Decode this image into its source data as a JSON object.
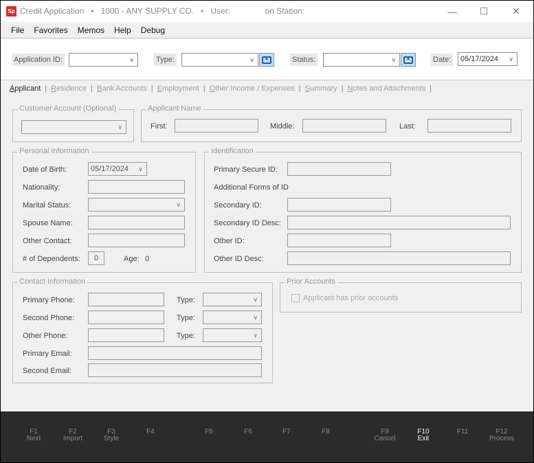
{
  "window": {
    "logo_text": "Sp",
    "title_parts": [
      "Credit Application",
      "•",
      "1000 - ANY SUPPLY CO.",
      "•",
      "User:",
      "",
      "on Station:"
    ],
    "controls": {
      "minimize": "—",
      "maximize": "☐",
      "close": "✕"
    }
  },
  "menu": [
    "File",
    "Favorites",
    "Memos",
    "Help",
    "Debug"
  ],
  "header": {
    "application_id_label": "Application ID:",
    "application_id_value": "",
    "type_label": "Type:",
    "type_value": "",
    "status_label": "Status:",
    "status_value": "",
    "date_label": "Date:",
    "date_value": "05/17/2024"
  },
  "tabs": [
    {
      "accel": "A",
      "rest": "pplicant",
      "active": true
    },
    {
      "accel": "R",
      "rest": "esidence",
      "active": false
    },
    {
      "accel": "B",
      "rest": "ank Accounts",
      "active": false
    },
    {
      "accel": "E",
      "rest": "mployment",
      "active": false
    },
    {
      "accel": "O",
      "rest": "ther Income / Expenses",
      "active": false
    },
    {
      "accel": "S",
      "rest": "ummary",
      "active": false
    },
    {
      "accel": "N",
      "rest": "otes and Attachments",
      "active": false
    }
  ],
  "customer_account": {
    "title": "Customer Account (Optional)",
    "value": ""
  },
  "applicant_name": {
    "title": "Applicant Name",
    "first_label": "First:",
    "first_value": "",
    "middle_label": "Middle:",
    "middle_value": "",
    "last_label": "Last:",
    "last_value": ""
  },
  "personal": {
    "title": "Personal Information",
    "dob_label": "Date of Birth:",
    "dob_value": "05/17/2024",
    "nationality_label": "Nationality:",
    "nationality_value": "",
    "marital_label": "Marital Status:",
    "marital_value": "",
    "spouse_label": "Spouse Name:",
    "spouse_value": "",
    "other_contact_label": "Other Contact:",
    "other_contact_value": "",
    "dependents_label": "# of Dependents:",
    "dependents_value": "0",
    "age_label": "Age:",
    "age_value": "0"
  },
  "identification": {
    "title": "Identification",
    "primary_label": "Primary Secure ID:",
    "primary_value": "",
    "additional_label": "Additional Forms of ID",
    "secondary_label": "Secondary ID:",
    "secondary_value": "",
    "secondary_desc_label": "Secondary ID Desc:",
    "secondary_desc_value": "",
    "other_label": "Other ID:",
    "other_value": "",
    "other_desc_label": "Other ID Desc:",
    "other_desc_value": ""
  },
  "contact": {
    "title": "Contact Information",
    "primary_phone_label": "Primary Phone:",
    "primary_phone_value": "",
    "second_phone_label": "Second Phone:",
    "second_phone_value": "",
    "other_phone_label": "Other Phone:",
    "other_phone_value": "",
    "type_label": "Type:",
    "primary_phone_type": "",
    "second_phone_type": "",
    "other_phone_type": "",
    "primary_email_label": "Primary Email:",
    "primary_email_value": "",
    "second_email_label": "Second Email:",
    "second_email_value": ""
  },
  "prior_accounts": {
    "title": "Prior Accounts",
    "checkbox_label": "Applicant has prior accounts",
    "checked": false
  },
  "footer": {
    "keys": [
      {
        "key": "F1",
        "desc": "Next",
        "active": false
      },
      {
        "key": "F2",
        "desc": "Import",
        "active": false
      },
      {
        "key": "F3",
        "desc": "Style",
        "active": false
      },
      {
        "key": "F4",
        "desc": "",
        "active": false
      },
      {
        "key": "F5",
        "desc": "",
        "active": false
      },
      {
        "key": "F6",
        "desc": "",
        "active": false
      },
      {
        "key": "F7",
        "desc": "",
        "active": false
      },
      {
        "key": "F8",
        "desc": "",
        "active": false
      },
      {
        "key": "F9",
        "desc": "Cancel",
        "active": false
      },
      {
        "key": "F10",
        "desc": "Exit",
        "active": true
      },
      {
        "key": "F11",
        "desc": "",
        "active": false
      },
      {
        "key": "F12",
        "desc": "Process",
        "active": false
      }
    ]
  },
  "colors": {
    "logo_red": "#e0282e",
    "footer_bg": "#2b2b2b",
    "picker_blue": "#c7dcf2",
    "picker_border": "#5b9bd5"
  }
}
